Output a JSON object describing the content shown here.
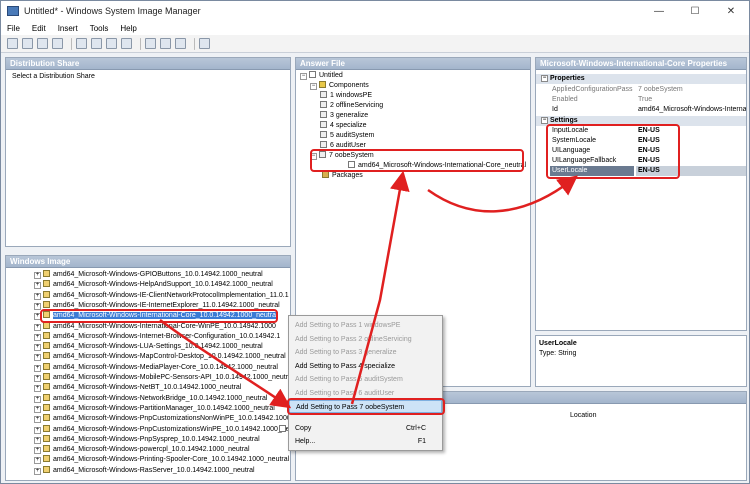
{
  "window": {
    "title": "Untitled* - Windows System Image Manager",
    "minimize": "—",
    "maximize": "☐",
    "close": "✕"
  },
  "menu": [
    "File",
    "Edit",
    "Insert",
    "Tools",
    "Help"
  ],
  "toolbar_icons": [
    "new-icon",
    "open-icon",
    "open-folder-icon",
    "save-icon",
    "cut-icon",
    "copy-icon",
    "paste-icon",
    "delete-icon",
    "find-icon",
    "validate-icon",
    "settings-icon",
    "help-icon"
  ],
  "distribution_share": {
    "header": "Distribution Share",
    "item": "Select a Distribution Share"
  },
  "windows_image": {
    "header": "Windows Image",
    "items": [
      "amd64_Microsoft-Windows-GPIOButtons_10.0.14942.1000_neutral",
      "amd64_Microsoft-Windows-HelpAndSupport_10.0.14942.1000_neutral",
      "amd64_Microsoft-Windows-IE-ClientNetworkProtocolImplementation_11.0.1",
      "amd64_Microsoft-Windows-IE-InternetExplorer_11.0.14942.1000_neutral",
      "amd64_Microsoft-Windows-International-Core_10.0.14942.1000_neutral",
      "amd64_Microsoft-Windows-International-Core-WinPE_10.0.14942.1000",
      "amd64_Microsoft-Windows-Internet-Browser-Configuration_10.0.14942.1",
      "amd64_Microsoft-Windows-LUA-Settings_10.0.14942.1000_neutral",
      "amd64_Microsoft-Windows-MapControl-Desktop_10.0.14942.1000_neutral",
      "amd64_Microsoft-Windows-MediaPlayer-Core_10.0.14942.1000_neutral",
      "amd64_Microsoft-Windows-MobilePC-Sensors-API_10.0.14942.1000_neutral",
      "amd64_Microsoft-Windows-NetBT_10.0.14942.1000_neutral",
      "amd64_Microsoft-Windows-NetworkBridge_10.0.14942.1000_neutral",
      "amd64_Microsoft-Windows-PartitionManager_10.0.14942.1000_neutral",
      "amd64_Microsoft-Windows-PnpCustomizationsNonWinPE_10.0.14942.1000",
      "amd64_Microsoft-Windows-PnpCustomizationsWinPE_10.0.14942.1000_neutral",
      "amd64_Microsoft-Windows-PnpSysprep_10.0.14942.1000_neutral",
      "amd64_Microsoft-Windows-powercpl_10.0.14942.1000_neutral",
      "amd64_Microsoft-Windows-Printing-Spooler-Core_10.0.14942.1000_neutral",
      "amd64_Microsoft-Windows-RasServer_10.0.14942.1000_neutral"
    ],
    "selected_index": 4
  },
  "answer_file": {
    "header": "Answer File",
    "root": "Untitled",
    "components": "Components",
    "passes": [
      "1 windowsPE",
      "2 offlineServicing",
      "3 generalize",
      "4 specialize",
      "5 auditSystem",
      "6 auditUser",
      "7 oobeSystem"
    ],
    "child": "amd64_Microsoft-Windows-International-Core_neutral",
    "packages": "Packages"
  },
  "properties": {
    "header": "Microsoft-Windows-International-Core Properties",
    "group1": "Properties",
    "rows1": [
      [
        "AppliedConfigurationPass",
        "7 oobeSystem"
      ],
      [
        "Enabled",
        "True"
      ],
      [
        "Id",
        "amd64_Microsoft-Windows-Internati"
      ]
    ],
    "group2": "Settings",
    "rows2": [
      [
        "InputLocale",
        "EN-US"
      ],
      [
        "SystemLocale",
        "EN-US"
      ],
      [
        "UILanguage",
        "EN-US"
      ],
      [
        "UILanguageFallback",
        "EN-US"
      ],
      [
        "UserLocale",
        "EN-US"
      ]
    ],
    "desc_title": "UserLocale",
    "desc_type": "Type: String"
  },
  "messages": {
    "location_header": "Location"
  },
  "context_menu": {
    "items": [
      {
        "label": "Add Setting to Pass 1 windowsPE",
        "enabled": false
      },
      {
        "label": "Add Setting to Pass 2 offlineServicing",
        "enabled": false
      },
      {
        "label": "Add Setting to Pass 3 generalize",
        "enabled": false
      },
      {
        "label": "Add Setting to Pass 4 specialize",
        "enabled": true
      },
      {
        "label": "Add Setting to Pass 5 auditSystem",
        "enabled": false
      },
      {
        "label": "Add Setting to Pass 6 auditUser",
        "enabled": false
      },
      {
        "label": "Add Setting to Pass 7 oobeSystem",
        "enabled": true
      }
    ],
    "copy": "Copy",
    "copy_shortcut": "Ctrl+C",
    "help": "Help...",
    "help_shortcut": "F1"
  },
  "colors": {
    "annotation": "#e02020",
    "selection": "#3a7bd5",
    "header": "#a3b5cc"
  }
}
